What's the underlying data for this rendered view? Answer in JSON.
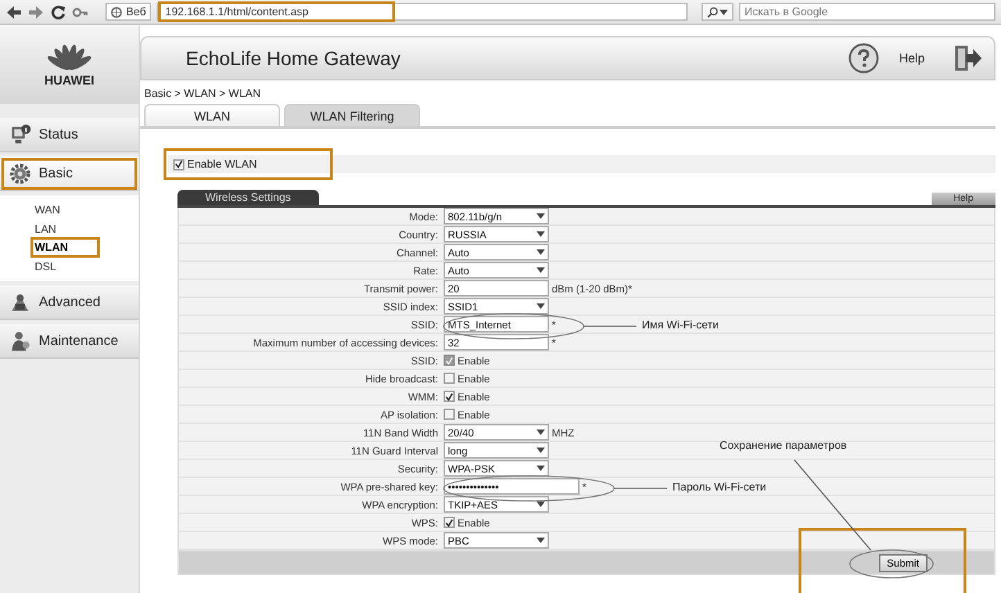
{
  "browser": {
    "engine_label": "Веб",
    "url": "192.168.1.1/html/content.asp",
    "url_highlighted": true,
    "search_placeholder": "Искать в Google"
  },
  "logo": {
    "text": "HUAWEI"
  },
  "header": {
    "title": "EchoLife Home Gateway",
    "help": "Help"
  },
  "sidebar": [
    {
      "label": "Status",
      "kind": "status",
      "selected": false,
      "highlighted": false
    },
    {
      "label": "Basic",
      "kind": "basic",
      "selected": true,
      "highlighted": true,
      "children": [
        {
          "label": "WAN",
          "selected": false,
          "highlighted": false
        },
        {
          "label": "LAN",
          "selected": false,
          "highlighted": false
        },
        {
          "label": "WLAN",
          "selected": true,
          "highlighted": true
        },
        {
          "label": "DSL",
          "selected": false,
          "highlighted": false
        }
      ]
    },
    {
      "label": "Advanced",
      "kind": "advanced",
      "selected": false,
      "highlighted": false
    },
    {
      "label": "Maintenance",
      "kind": "maintenance",
      "selected": false,
      "highlighted": false
    }
  ],
  "breadcrumb": "Basic > WLAN > WLAN",
  "tabs": [
    {
      "label": "WLAN",
      "selected": true
    },
    {
      "label": "WLAN Filtering",
      "selected": false
    }
  ],
  "enable_wlan": {
    "label": "Enable WLAN",
    "checked": true,
    "highlighted": true
  },
  "settings": {
    "title": "Wireless Settings",
    "help": "Help",
    "rows": [
      {
        "label": "Mode:",
        "kind": "select",
        "value": "802.11b/g/n"
      },
      {
        "label": "Country:",
        "kind": "select",
        "value": "RUSSIA"
      },
      {
        "label": "Channel:",
        "kind": "select",
        "value": "Auto"
      },
      {
        "label": "Rate:",
        "kind": "select",
        "value": "Auto"
      },
      {
        "label": "Transmit power:",
        "kind": "text",
        "value": "20",
        "suffix": "dBm (1-20 dBm)*"
      },
      {
        "label": "SSID index:",
        "kind": "select",
        "value": "SSID1"
      },
      {
        "label": "SSID:",
        "kind": "text",
        "value": "MTS_Internet",
        "suffix": "*",
        "circled": true,
        "callout": "Имя Wi-Fi-сети"
      },
      {
        "label": "Maximum number of accessing devices:",
        "kind": "text",
        "value": "32",
        "suffix": "*"
      },
      {
        "label": "SSID:",
        "kind": "checkbox",
        "option": "Enable",
        "checked": true,
        "disabled": true
      },
      {
        "label": "Hide broadcast:",
        "kind": "checkbox",
        "option": "Enable",
        "checked": false,
        "disabled": false
      },
      {
        "label": "WMM:",
        "kind": "checkbox",
        "option": "Enable",
        "checked": true,
        "disabled": false
      },
      {
        "label": "AP isolation:",
        "kind": "checkbox",
        "option": "Enable",
        "checked": false,
        "disabled": false
      },
      {
        "label": "11N Band Width",
        "kind": "select",
        "value": "20/40",
        "suffix": "MHZ"
      },
      {
        "label": "11N Guard Interval",
        "kind": "select",
        "value": "long"
      },
      {
        "label": "Security:",
        "kind": "select",
        "value": "WPA-PSK"
      },
      {
        "label": "WPA pre-shared key:",
        "kind": "password",
        "value": "••••••••••••••",
        "suffix": "*",
        "circled": true,
        "callout": "Пароль Wi-Fi-сети"
      },
      {
        "label": "WPA encryption:",
        "kind": "select",
        "value": "TKIP+AES"
      },
      {
        "label": "WPS:",
        "kind": "checkbox",
        "option": "Enable",
        "checked": true,
        "disabled": false
      },
      {
        "label": "WPS mode:",
        "kind": "select",
        "value": "PBC"
      }
    ],
    "submit": {
      "label": "Submit",
      "circled": true,
      "highlighted": true,
      "callout": "Сохранение параметров"
    }
  }
}
